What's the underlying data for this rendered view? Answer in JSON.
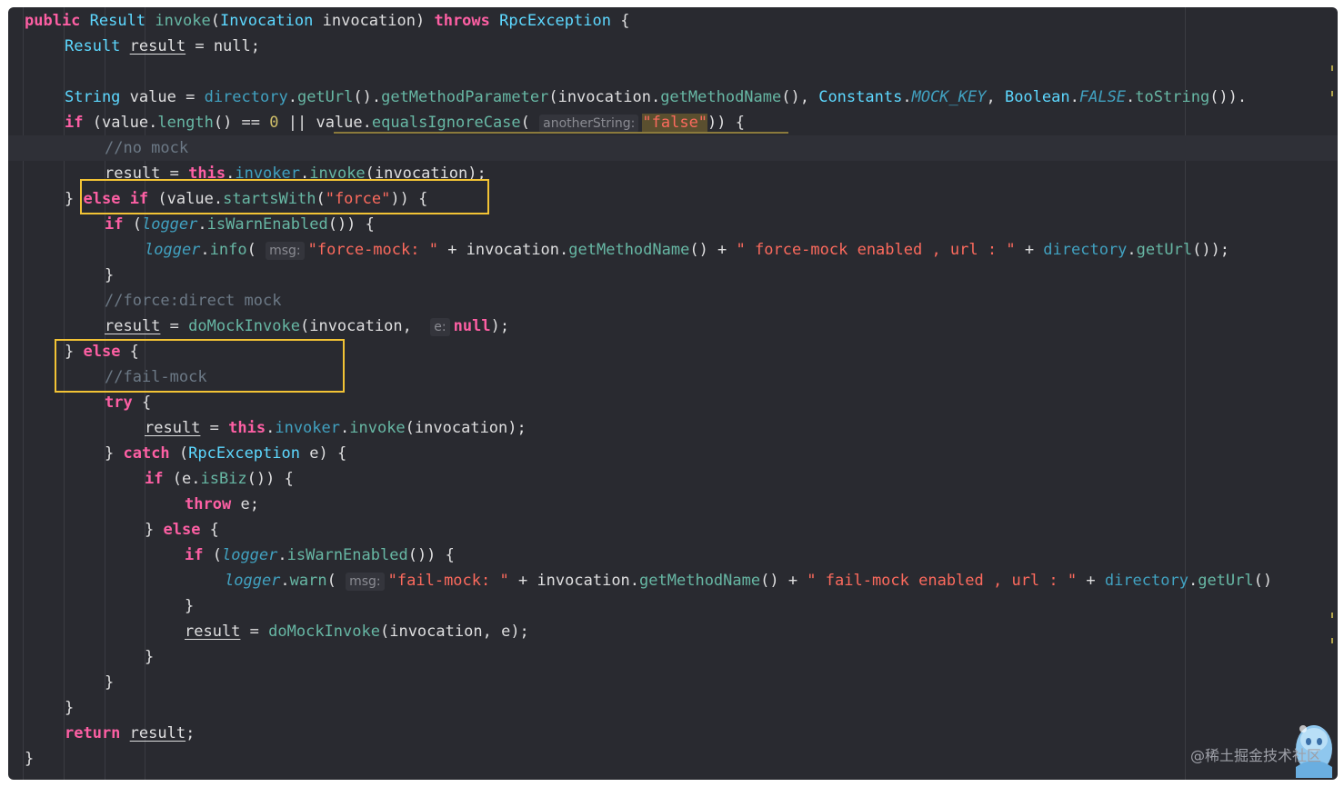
{
  "code": {
    "keyword_public": "public",
    "type_result": "Result",
    "method_invoke": "invoke",
    "type_invocation": "Invocation",
    "param_invocation": "invocation",
    "keyword_throws": "throws",
    "type_rpc_exception": "RpcException",
    "var_result": "result",
    "null_value": "null",
    "type_string": "String",
    "var_value": "value",
    "field_directory": "directory",
    "method_get_url": "getUrl",
    "method_get_method_parameter": "getMethodParameter",
    "method_get_method_name": "getMethodName",
    "class_constants": "Constants",
    "const_mock_key": "MOCK_KEY",
    "class_boolean": "Boolean",
    "const_false": "FALSE",
    "method_to_string": "toString",
    "keyword_if": "if",
    "method_length": "length",
    "num_zero": "0",
    "method_equals_ignore_case": "equalsIgnoreCase",
    "hint_another_string": "anotherString:",
    "str_false": "\"false\"",
    "comment_no_mock": "//no mock",
    "keyword_this": "this",
    "field_invoker": "invoker",
    "keyword_else": "else",
    "method_starts_with": "startsWith",
    "str_force": "\"force\"",
    "field_logger": "logger",
    "method_is_warn_enabled": "isWarnEnabled",
    "method_info": "info",
    "hint_msg": "msg:",
    "str_force_mock": "\"force-mock: \"",
    "str_force_mock_enabled": "\" force-mock enabled , url : \"",
    "comment_force_direct": "//force:direct mock",
    "method_do_mock_invoke": "doMockInvoke",
    "hint_e": "e:",
    "comment_fail_mock": "//fail-mock",
    "keyword_try": "try",
    "keyword_catch": "catch",
    "var_e": "e",
    "method_is_biz": "isBiz",
    "keyword_throw": "throw",
    "method_warn": "warn",
    "str_fail_mock": "\"fail-mock: \"",
    "str_fail_mock_enabled": "\" fail-mock enabled , url : \"",
    "keyword_return": "return"
  },
  "watermark": "@稀土掘金技术社区",
  "colors": {
    "background": "#292a30",
    "keyword": "#fc5fa3",
    "type": "#5dd8ff",
    "method": "#67b7a4",
    "field": "#41a1c0",
    "string": "#fc6a5d",
    "number": "#d0bf69",
    "comment": "#6c7986",
    "highlight_box": "#f2c335"
  }
}
